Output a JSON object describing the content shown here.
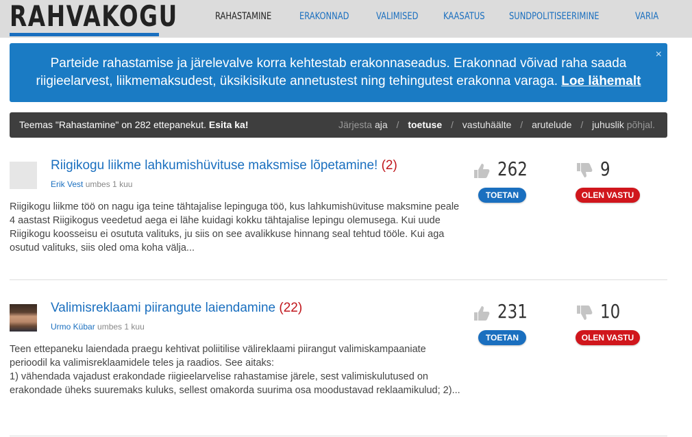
{
  "header": {
    "logo": "RAHVAKOGU",
    "nav": [
      "RAHASTAMINE",
      "ERAKONNAD",
      "VALIMISED",
      "KAASATUS",
      "SUNDPOLITISEERIMINE",
      "VARIA"
    ]
  },
  "banner": {
    "line1": "Parteide rahastamise ja järelevalve korra kehtestab erakonnaseadus. Erakonnad võivad raha saada",
    "line2": "riigieelarvest, liikmemaksudest, üksikisikute annetustest ning tehingutest erakonna varaga.",
    "link": "Loe lähemalt",
    "close": "×"
  },
  "sortbar": {
    "summary": "Teemas \"Rahastamine\" on 282 ettepanekut.",
    "cta": "Esita ka!",
    "sort_prefix": "Järjesta",
    "options": [
      "aja",
      "toetuse",
      "vastuhäälte",
      "arutelude",
      "juhuslik"
    ],
    "sort_suffix": "põhjal.",
    "active_index": 1
  },
  "proposals": [
    {
      "title": "Riigikogu liikme lahkumishüvituse maksmise lõpetamine!",
      "comments": "(2)",
      "author": "Erik Vest",
      "time": "umbes 1 kuu",
      "body": "Riigikogu liikme töö on nagu iga teine tähtajalise lepinguga töö, kus lahkumishüvituse maksmine peale 4 aastast Riigikogus veedetud aega ei lähe kuidagi kokku tähtajalise lepingu olemusega. Kui uude Riigikogu koosseisu ei osututa valituks, ju siis on see avalikkuse hinnang seal tehtud tööle. Kui aga osutud valituks, siis oled oma koha välja...",
      "support": "262",
      "oppose": "9",
      "support_label": "TOETAN",
      "oppose_label": "OLEN VASTU"
    },
    {
      "title": "Valimisreklaami piirangute laiendamine",
      "comments": "(22)",
      "author": "Urmo Kübar",
      "time": "umbes 1 kuu",
      "body_lines": [
        "Teen ettepaneku laiendada praegu kehtivat poliitilise välireklaami piirangut valimiskampaaniate perioodil ka valimisreklaamidele teles ja raadios. See aitaks:",
        "1) vähendada vajadust erakondade riigieelarvelise rahastamise järele, sest valimiskulutused on erakondade üheks suuremaks kuluks, sellest omakorda suurima osa moodustavad reklaamikulud; 2)..."
      ],
      "support": "231",
      "oppose": "10",
      "support_label": "TOETAN",
      "oppose_label": "OLEN VASTU"
    }
  ],
  "colors": {
    "brand_blue": "#1a6fbf",
    "banner_blue": "#1a7bc4",
    "oppose_red": "#d0161c",
    "sortbar_bg": "#3e3e3e",
    "header_bg": "#dcdcdc"
  }
}
